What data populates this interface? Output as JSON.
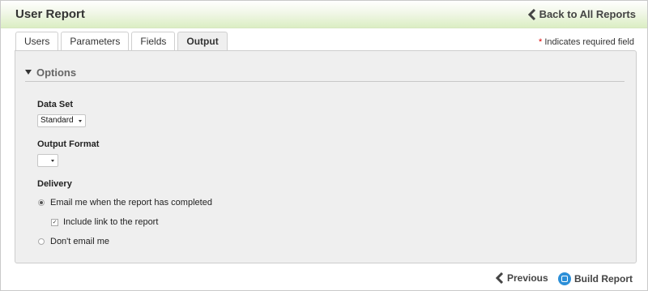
{
  "header": {
    "title": "User Report",
    "back_label": "Back to All Reports"
  },
  "tabs": [
    {
      "label": "Users"
    },
    {
      "label": "Parameters"
    },
    {
      "label": "Fields"
    },
    {
      "label": "Output",
      "active": true
    }
  ],
  "required_note": {
    "star": "*",
    "text": " Indicates required field"
  },
  "options": {
    "section_title": "Options",
    "data_set": {
      "label": "Data Set",
      "selected": "Standard"
    },
    "output_format": {
      "label": "Output Format",
      "selected": ""
    },
    "delivery": {
      "label": "Delivery",
      "email_option": "Email me when the report has completed",
      "include_link": "Include link to the report",
      "no_email_option": "Don't email me",
      "email_selected": true,
      "include_link_checked": true
    }
  },
  "footer": {
    "previous_label": "Previous",
    "build_label": "Build Report"
  },
  "colors": {
    "header_gradient_end": "#dbeec3",
    "required_star": "#dd0000",
    "build_icon": "#2c8fd8"
  }
}
